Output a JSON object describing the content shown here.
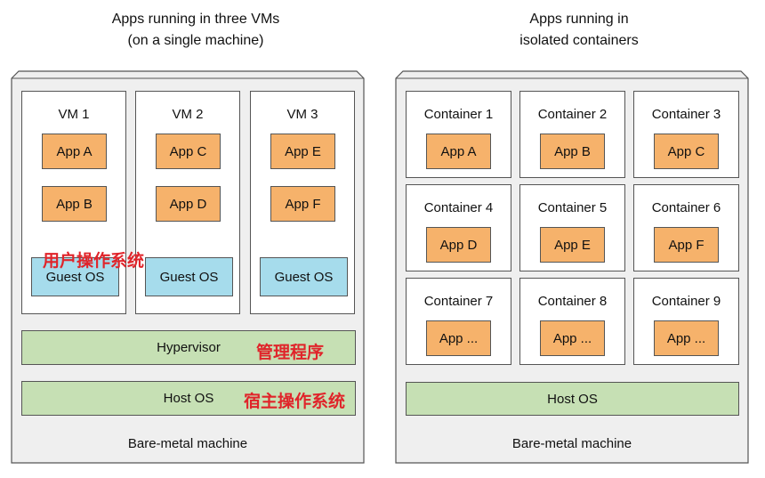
{
  "left": {
    "title_line1": "Apps running in three VMs",
    "title_line2": "(on a single machine)",
    "vms": [
      {
        "label": "VM 1",
        "apps": [
          "App A",
          "App B"
        ],
        "os": "Guest OS"
      },
      {
        "label": "VM 2",
        "apps": [
          "App C",
          "App D"
        ],
        "os": "Guest OS"
      },
      {
        "label": "VM 3",
        "apps": [
          "App E",
          "App F"
        ],
        "os": "Guest OS"
      }
    ],
    "hypervisor": "Hypervisor",
    "host_os": "Host OS",
    "machine": "Bare-metal machine",
    "annotations": {
      "guest_os": "用户操作系统",
      "hypervisor": "管理程序",
      "host_os": "宿主操作系统"
    }
  },
  "right": {
    "title_line1": "Apps running in",
    "title_line2": "isolated containers",
    "containers": [
      {
        "label": "Container 1",
        "app": "App A"
      },
      {
        "label": "Container 2",
        "app": "App B"
      },
      {
        "label": "Container 3",
        "app": "App C"
      },
      {
        "label": "Container 4",
        "app": "App D"
      },
      {
        "label": "Container 5",
        "app": "App E"
      },
      {
        "label": "Container 6",
        "app": "App F"
      },
      {
        "label": "Container 7",
        "app": "App ..."
      },
      {
        "label": "Container 8",
        "app": "App ..."
      },
      {
        "label": "Container 9",
        "app": "App ..."
      }
    ],
    "host_os": "Host OS",
    "machine": "Bare-metal machine"
  },
  "colors": {
    "app": "#f6b26b",
    "guest_os": "#a6dcec",
    "layer": "#c6e0b4",
    "machine": "#efefef",
    "annotation": "#e0242a"
  }
}
